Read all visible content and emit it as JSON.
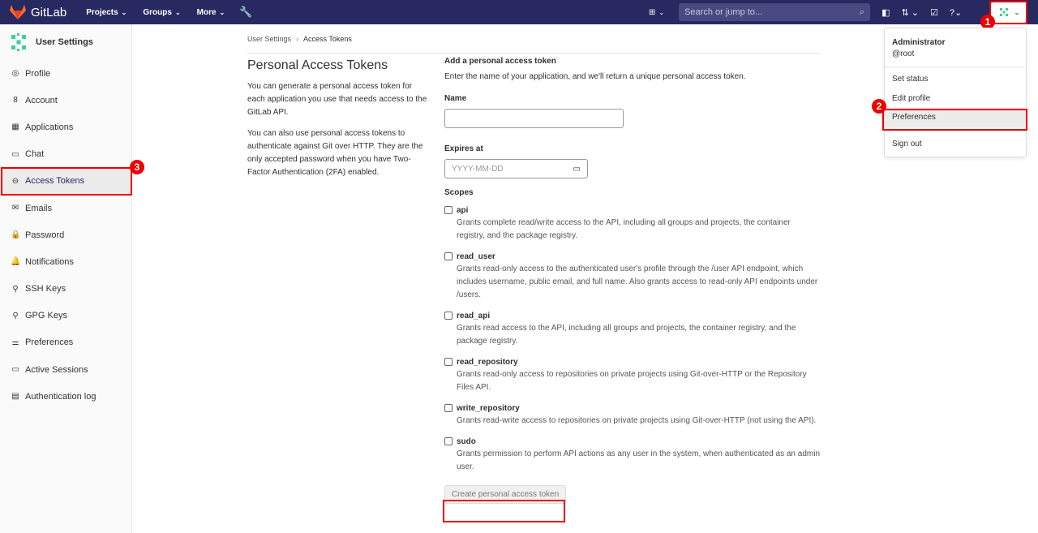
{
  "topbar": {
    "brand": "GitLab",
    "nav": [
      {
        "label": "Projects"
      },
      {
        "label": "Groups"
      },
      {
        "label": "More"
      }
    ],
    "search_placeholder": "Search or jump to..."
  },
  "sidebar": {
    "title": "User Settings",
    "items": [
      {
        "label": "Profile",
        "icon": "profile-icon",
        "glyph": "◎"
      },
      {
        "label": "Account",
        "icon": "account-icon",
        "glyph": "8"
      },
      {
        "label": "Applications",
        "icon": "applications-icon",
        "glyph": "▦"
      },
      {
        "label": "Chat",
        "icon": "chat-icon",
        "glyph": "▭"
      },
      {
        "label": "Access Tokens",
        "icon": "token-icon",
        "glyph": "⊖",
        "active": true
      },
      {
        "label": "Emails",
        "icon": "envelope-icon",
        "glyph": "✉"
      },
      {
        "label": "Password",
        "icon": "lock-icon",
        "glyph": "🔒"
      },
      {
        "label": "Notifications",
        "icon": "bell-icon",
        "glyph": "🔔"
      },
      {
        "label": "SSH Keys",
        "icon": "key-icon",
        "glyph": "⚲"
      },
      {
        "label": "GPG Keys",
        "icon": "key-icon",
        "glyph": "⚲"
      },
      {
        "label": "Preferences",
        "icon": "preferences-icon",
        "glyph": "⚌"
      },
      {
        "label": "Active Sessions",
        "icon": "monitor-icon",
        "glyph": "▭"
      },
      {
        "label": "Authentication log",
        "icon": "log-icon",
        "glyph": "▤"
      }
    ]
  },
  "breadcrumb": {
    "parent": "User Settings",
    "current": "Access Tokens"
  },
  "intro": {
    "title": "Personal Access Tokens",
    "p1": "You can generate a personal access token for each application you use that needs access to the GitLab API.",
    "p2": "You can also use personal access tokens to authenticate against Git over HTTP. They are the only accepted password when you have Two-Factor Authentication (2FA) enabled."
  },
  "form": {
    "title": "Add a personal access token",
    "desc": "Enter the name of your application, and we'll return a unique personal access token.",
    "name_label": "Name",
    "name_value": "",
    "expires_label": "Expires at",
    "expires_placeholder": "YYYY-MM-DD",
    "scopes_label": "Scopes",
    "scopes": [
      {
        "name": "api",
        "desc": "Grants complete read/write access to the API, including all groups and projects, the container registry, and the package registry.",
        "checked": false
      },
      {
        "name": "read_user",
        "desc": "Grants read-only access to the authenticated user's profile through the /user API endpoint, which includes username, public email, and full name. Also grants access to read-only API endpoints under /users.",
        "checked": false
      },
      {
        "name": "read_api",
        "desc": "Grants read access to the API, including all groups and projects, the container registry, and the package registry.",
        "checked": false
      },
      {
        "name": "read_repository",
        "desc": "Grants read-only access to repositories on private projects using Git-over-HTTP or the Repository Files API.",
        "checked": false
      },
      {
        "name": "write_repository",
        "desc": "Grants read-write access to repositories on private projects using Git-over-HTTP (not using the API).",
        "checked": false
      },
      {
        "name": "sudo",
        "desc": "Grants permission to perform API actions as any user in the system, when authenticated as an admin user.",
        "checked": false
      }
    ],
    "submit_label": "Create personal access token"
  },
  "user_menu": {
    "name": "Administrator",
    "username": "@root",
    "items": [
      "Set status",
      "Edit profile",
      "Preferences",
      "Sign out"
    ]
  },
  "annotations": [
    "1",
    "2",
    "3"
  ]
}
